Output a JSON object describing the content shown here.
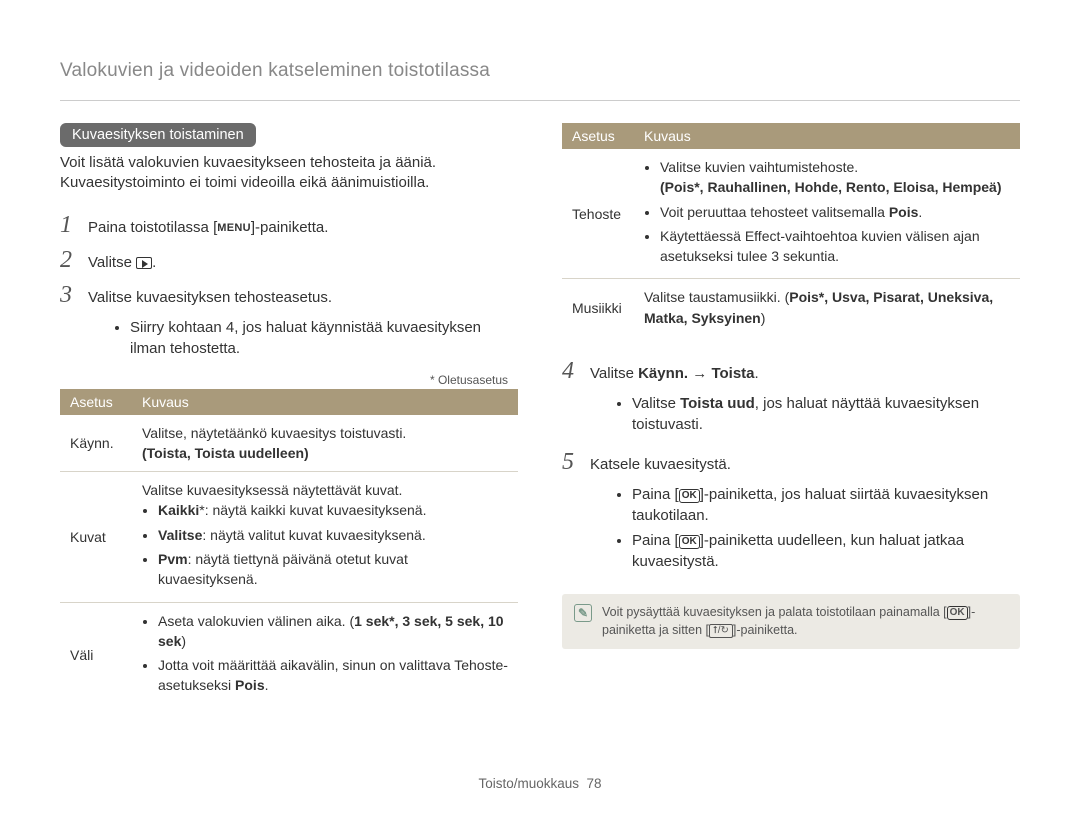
{
  "header_title": "Valokuvien ja videoiden katseleminen toistotilassa",
  "section_title": "Kuvaesityksen toistaminen",
  "intro_line1": "Voit lisätä valokuvien kuvaesitykseen tehosteita ja ääniä.",
  "intro_line2": "Kuvaesitystoiminto ei toimi videoilla eikä äänimuistioilla.",
  "steps_left": {
    "s1_pre": "Paina toistotilassa [",
    "s1_kbd": "MENU",
    "s1_post": "]-painiketta.",
    "s2": "Valitse ",
    "s3": "Valitse kuvaesityksen tehosteasetus.",
    "s3_bullet": "Siirry kohtaan 4, jos haluat käynnistää kuvaesityksen ilman tehostetta."
  },
  "default_note": "* Oletusasetus",
  "table_left": {
    "h1": "Asetus",
    "h2": "Kuvaus",
    "rows": [
      {
        "name": "Käynn.",
        "main": "Valitse, näytetäänkö kuvaesitys toistuvasti.",
        "bold": "(Toista, Toista uudelleen)"
      },
      {
        "name": "Kuvat",
        "main": "Valitse kuvaesityksessä näytettävät kuvat.",
        "b1_pre": "Kaikki",
        "b1_post": "*: näytä kaikki kuvat kuvaesityksenä.",
        "b2_pre": "Valitse",
        "b2_post": ": näytä valitut kuvat kuvaesityksenä.",
        "b3_pre": "Pvm",
        "b3_post": ": näytä tiettynä päivänä otetut kuvat kuvaesityksenä."
      },
      {
        "name": "Väli",
        "b1_pre": "Aseta valokuvien välinen aika. (",
        "b1_bold": "1 sek*, 3 sek, 5 sek, 10 sek",
        "b1_post": ")",
        "b2": "Jotta voit määrittää aikavälin, sinun on valittava Tehoste-asetukseksi ",
        "b2_bold": "Pois"
      }
    ]
  },
  "table_right": {
    "h1": "Asetus",
    "h2": "Kuvaus",
    "rows": [
      {
        "name": "Tehoste",
        "b1": "Valitse kuvien vaihtumistehoste.",
        "b1_bold": "(Pois*, Rauhallinen, Hohde, Rento, Eloisa, Hempeä)",
        "b2_pre": "Voit peruuttaa tehosteet valitsemalla ",
        "b2_bold": "Pois",
        "b3": "Käytettäessä Effect-vaihtoehtoa kuvien välisen ajan asetukseksi tulee 3 sekuntia."
      },
      {
        "name": "Musiikki",
        "main_pre": "Valitse taustamusiikki. (",
        "main_bold": "Pois*, Usva, Pisarat, Uneksiva, Matka, Syksyinen",
        "main_post": ")"
      }
    ]
  },
  "steps_right": {
    "s4_pre": "Valitse ",
    "s4_bold1": "Käynn.",
    "s4_arrow": " → ",
    "s4_bold2": "Toista",
    "s4_bullet_pre": "Valitse ",
    "s4_bullet_bold": "Toista uud",
    "s4_bullet_post": ", jos haluat näyttää kuvaesityksen toistuvasti.",
    "s5": "Katsele kuvaesitystä.",
    "s5_b1_pre": "Paina [",
    "s5_b1_post": "]-painiketta, jos haluat siirtää kuvaesityksen taukotilaan.",
    "s5_b2_pre": "Paina [",
    "s5_b2_post": "]-painiketta uudelleen, kun haluat jatkaa kuvaesitystä."
  },
  "note": {
    "text_pre": "Voit pysäyttää kuvaesityksen ja palata toistotilaan painamalla [",
    "text_mid": "]-painiketta ja sitten [",
    "combo": "⭡/↻",
    "text_post": "]-painiketta."
  },
  "ok_label": "OK",
  "footer_section": "Toisto/muokkaus",
  "footer_page": "78"
}
